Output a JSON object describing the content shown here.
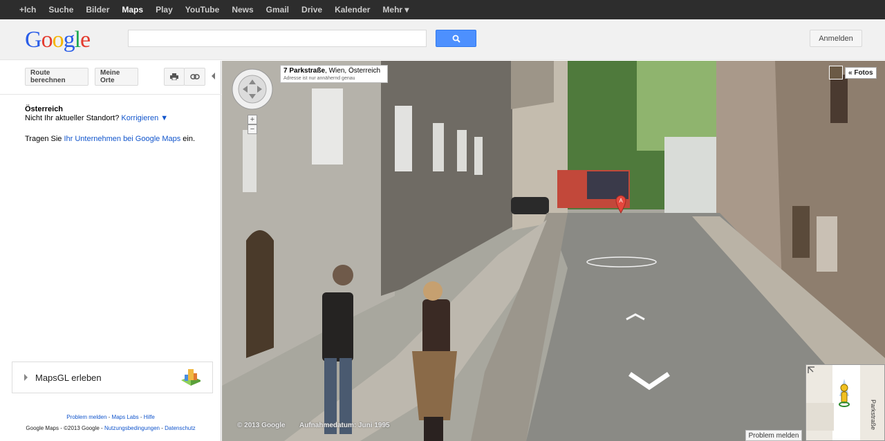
{
  "gbar": {
    "items": [
      "+Ich",
      "Suche",
      "Bilder",
      "Maps",
      "Play",
      "YouTube",
      "News",
      "Gmail",
      "Drive",
      "Kalender",
      "Mehr ▾"
    ],
    "active": "Maps"
  },
  "header": {
    "logo_letters": [
      "G",
      "o",
      "o",
      "g",
      "l",
      "e"
    ],
    "logo_colors": [
      "#2b5ee8",
      "#e33b2e",
      "#f5b400",
      "#2b5ee8",
      "#1da851",
      "#e33b2e"
    ],
    "search_placeholder": "",
    "signin_label": "Anmelden"
  },
  "panel": {
    "route_button": "Route berechnen",
    "my_places_button": "Meine Orte",
    "location_title": "Österreich",
    "location_prompt": "Nicht Ihr aktueller Standort?",
    "correct_link": "Korrigieren ▼",
    "biz_prefix": "Tragen Sie",
    "biz_link": "Ihr Unternehmen bei Google Maps",
    "biz_suffix": "ein.",
    "mapsgl_label": "MapsGL erleben",
    "footer_links": [
      "Problem melden",
      "Maps Labs",
      "Hilfe"
    ],
    "footer_text": "Google Maps - ©2013 Google -",
    "footer_links2": [
      "Nutzungsbedingungen",
      "Datenschutz"
    ]
  },
  "streetview": {
    "address_bold": "7 Parkstraße",
    "address_rest": ", Wien, Österreich",
    "address_note": "Adresse ist nur annähernd genau",
    "fotos_label": "« Fotos",
    "copyright": "© 2013 Google",
    "capture_date": "Aufnahmedatum: Juni 1995",
    "problem_label": "Problem melden",
    "minimap_street": "Parkstraße",
    "marker_letter": "A"
  },
  "colors": {
    "accent": "#4d90fe",
    "link": "#1155cc",
    "marker": "#e5473d"
  }
}
